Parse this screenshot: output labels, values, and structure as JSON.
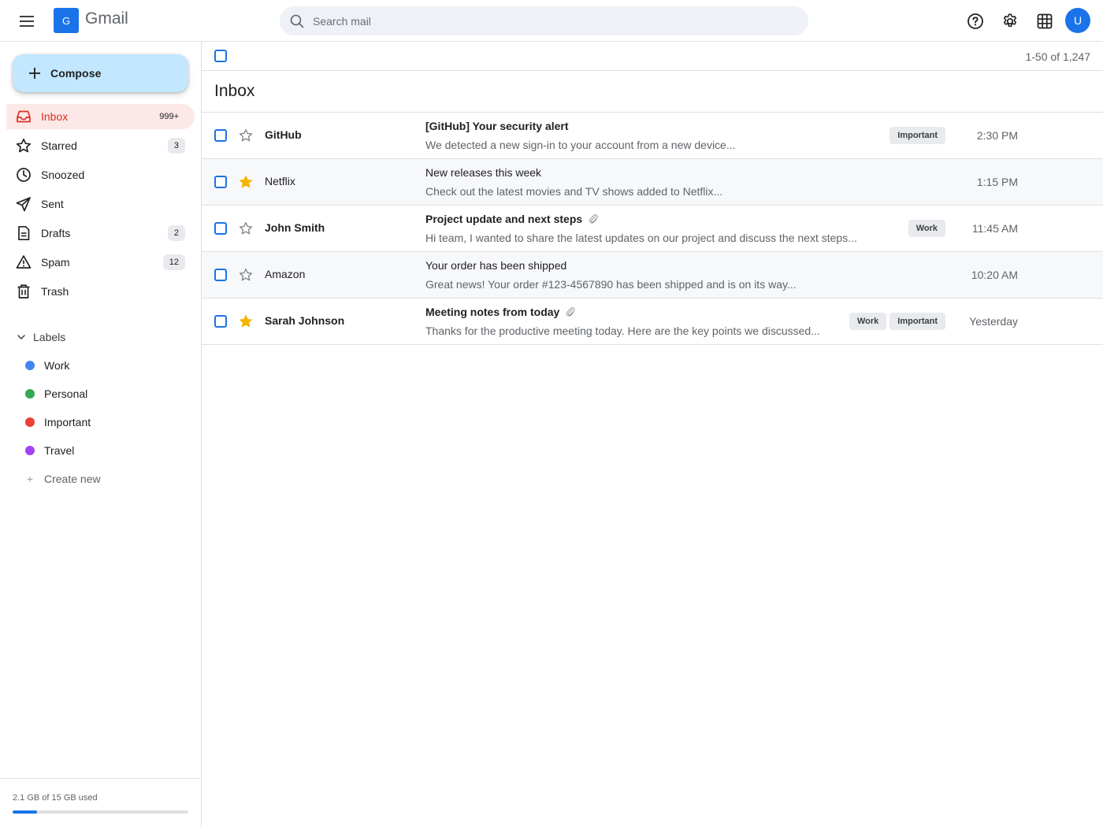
{
  "app": {
    "logo_letter": "G",
    "name": "Gmail"
  },
  "search": {
    "placeholder": "Search mail"
  },
  "user": {
    "avatar_initial": "U"
  },
  "compose": {
    "label": "Compose"
  },
  "nav": [
    {
      "label": "Inbox",
      "count": "999+",
      "icon": "inbox-icon"
    },
    {
      "label": "Starred",
      "count": "3",
      "icon": "star-icon"
    },
    {
      "label": "Snoozed",
      "count": "",
      "icon": "clock-icon"
    },
    {
      "label": "Sent",
      "count": "",
      "icon": "send-icon"
    },
    {
      "label": "Drafts",
      "count": "2",
      "icon": "draft-icon"
    },
    {
      "label": "Spam",
      "count": "12",
      "icon": "warning-icon"
    },
    {
      "label": "Trash",
      "count": "",
      "icon": "trash-icon"
    }
  ],
  "labels": {
    "heading": "Labels",
    "items": [
      {
        "name": "Work",
        "color": "#4285f4"
      },
      {
        "name": "Personal",
        "color": "#34a853"
      },
      {
        "name": "Important",
        "color": "#ea4335"
      },
      {
        "name": "Travel",
        "color": "#a142f4"
      }
    ],
    "create_new": "Create new"
  },
  "storage": {
    "text": "2.1 GB of 15 GB used",
    "used_fraction": 0.14
  },
  "toolbar": {
    "range": "1-50 of 1,247"
  },
  "inbox": {
    "title": "Inbox"
  },
  "emails": [
    {
      "sender": "GitHub",
      "subject": "[GitHub] Your security alert",
      "snippet": "We detected a new sign-in to your account from a new device...",
      "time": "2:30 PM",
      "tags": [
        "Important"
      ],
      "starred": false,
      "unread": true,
      "attachment": false
    },
    {
      "sender": "Netflix",
      "subject": "New releases this week",
      "snippet": "Check out the latest movies and TV shows added to Netflix...",
      "time": "1:15 PM",
      "tags": [],
      "starred": true,
      "unread": false,
      "attachment": false
    },
    {
      "sender": "John Smith",
      "subject": "Project update and next steps",
      "snippet": "Hi team, I wanted to share the latest updates on our project and discuss the next steps...",
      "time": "11:45 AM",
      "tags": [
        "Work"
      ],
      "starred": false,
      "unread": true,
      "attachment": true
    },
    {
      "sender": "Amazon",
      "subject": "Your order has been shipped",
      "snippet": "Great news! Your order #123-4567890 has been shipped and is on its way...",
      "time": "10:20 AM",
      "tags": [],
      "starred": false,
      "unread": false,
      "attachment": false
    },
    {
      "sender": "Sarah Johnson",
      "subject": "Meeting notes from today",
      "snippet": "Thanks for the productive meeting today. Here are the key points we discussed...",
      "time": "Yesterday",
      "tags": [
        "Work",
        "Important"
      ],
      "starred": true,
      "unread": true,
      "attachment": true
    }
  ],
  "colors": {
    "accent": "#1a73e8",
    "inbox_active_bg": "#fce8e6",
    "inbox_active_text": "#d93025",
    "compose_bg": "#c2e7ff",
    "star_filled": "#f4b400"
  }
}
